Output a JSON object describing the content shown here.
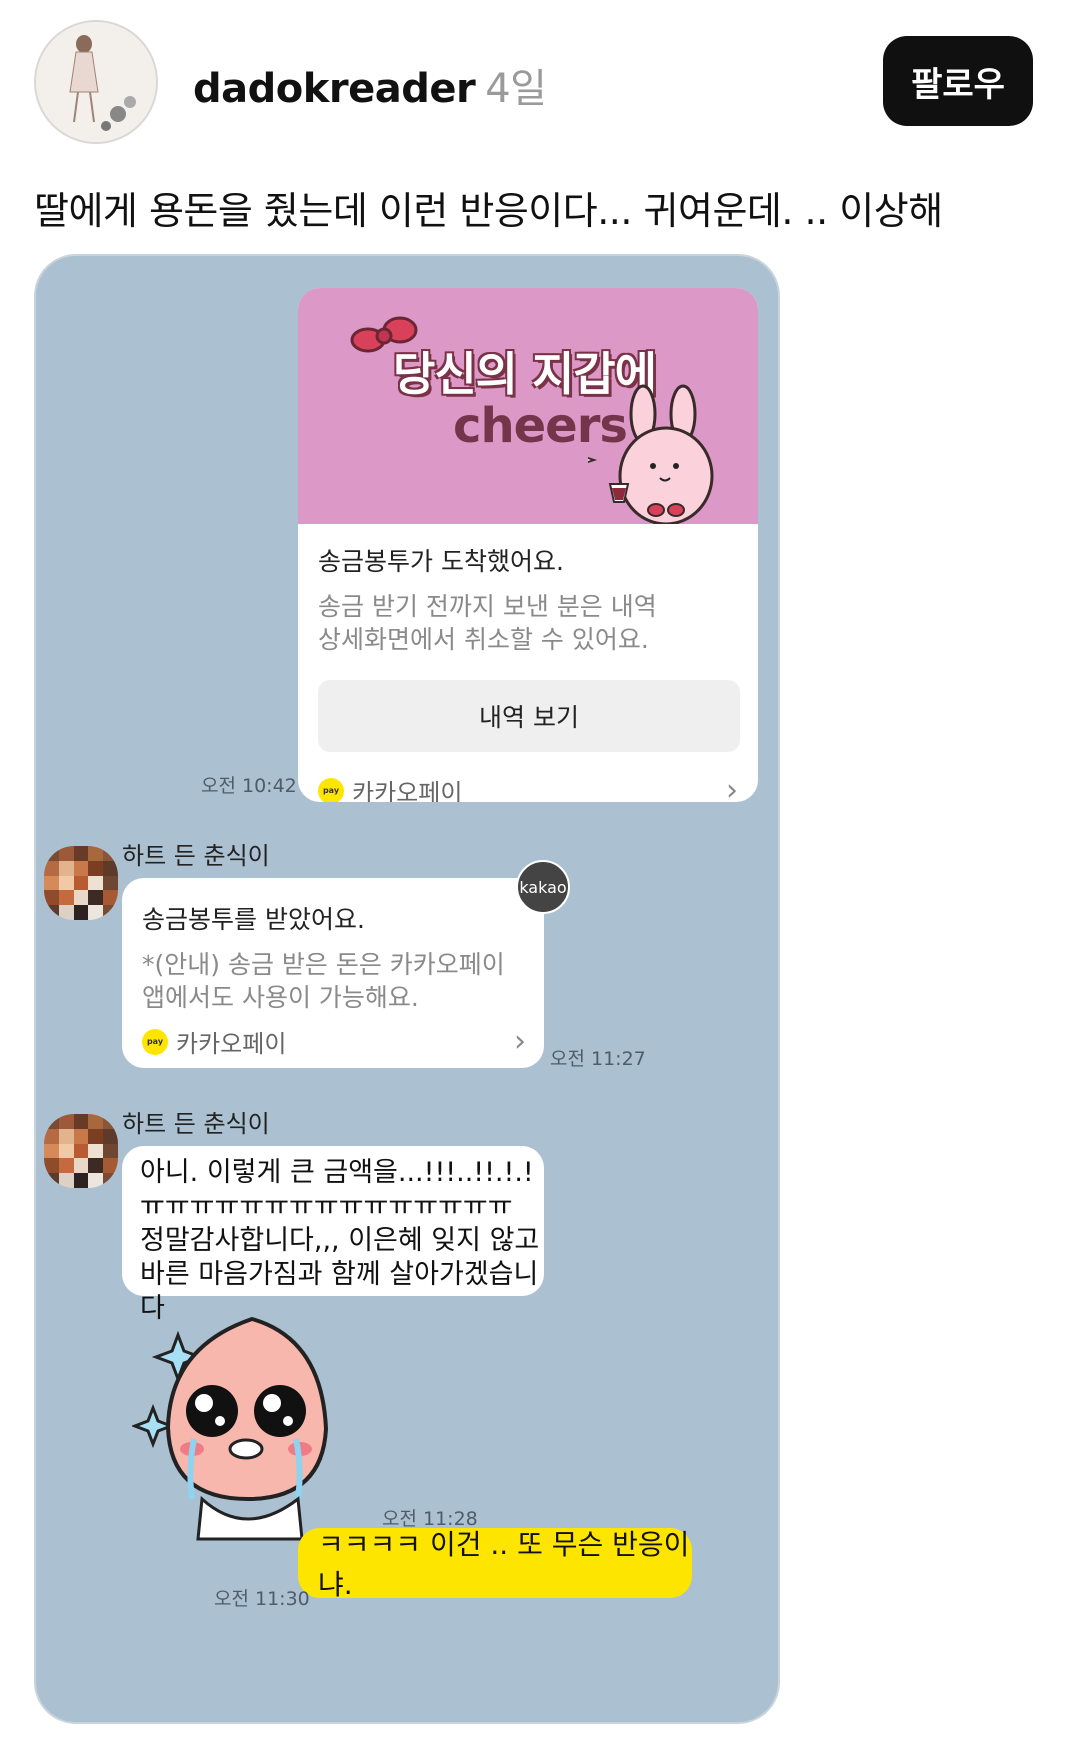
{
  "post": {
    "username": "dadokreader",
    "time_ago": "4일",
    "follow_label": "팔로우",
    "caption": "딸에게 용돈을 줬는데 이런 반응이다... 귀여운데. .. 이상해"
  },
  "chat": {
    "transfer_card": {
      "banner_title": "당신의 지갑에",
      "banner_sub": "cheers",
      "title": "송금봉투가 도착했어요.",
      "desc_line1": "송금 받기 전까지 보낸 분은 내역",
      "desc_line2": "상세화면에서 취소할 수 있어요.",
      "button": "내역 보기",
      "pay_brand": "카카오페이",
      "pay_icon_text": "pay",
      "time": "오전 10:42"
    },
    "received_card": {
      "sender": "하트 든 춘식이",
      "badge": "kakao",
      "title": "송금봉투를 받았어요.",
      "desc_line1": "*(안내) 송금 받은 돈은 카카오페이",
      "desc_line2": "앱에서도 사용이 가능해요.",
      "pay_brand": "카카오페이",
      "pay_icon_text": "pay",
      "time": "오전 11:27"
    },
    "text_message": {
      "sender": "하트 든 춘식이",
      "line1": "아니. 이렇게 큰 금액을...!!!..!!.!.!ㅠ",
      "line2": "ㅠㅠㅠㅠㅠㅠㅠㅠㅠㅠㅠㅠㅠㅠㅠ",
      "line3": "정말감사합니다,,, 이은혜 잊지 않고",
      "line4": "바른 마음가짐과 함께 살아가겠습니다"
    },
    "sticker": {
      "icon": "crying-peach-sticker",
      "time": "오전 11:28"
    },
    "my_message": {
      "text": "ㅋㅋㅋㅋ 이건 .. 또 무슨 반응이냐.",
      "time": "오전 11:30"
    }
  },
  "colors": {
    "chat_bg": "#abc1d1",
    "banner_pink": "#dc98c6",
    "kakao_yellow": "#fee500",
    "follow_button": "#101010"
  }
}
